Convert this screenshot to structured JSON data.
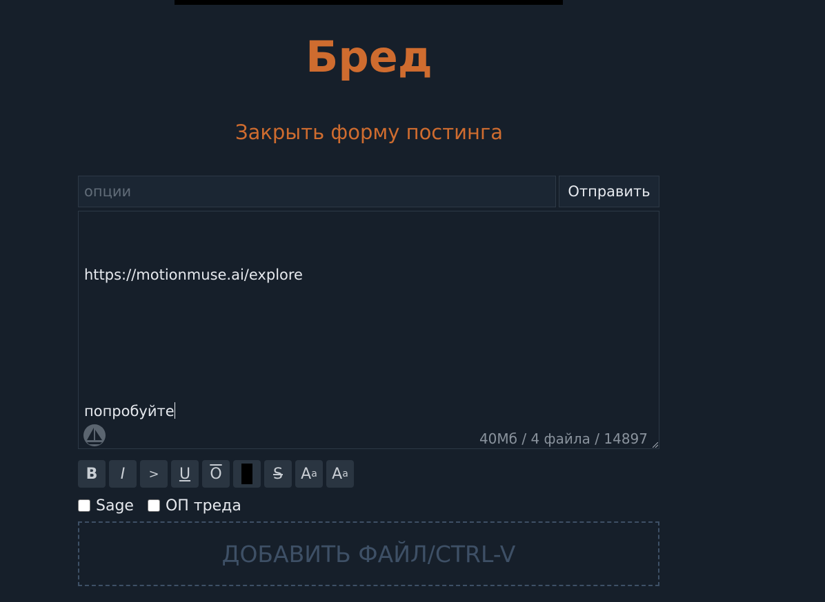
{
  "board": {
    "title": "Бред"
  },
  "form": {
    "close_label": "Закрыть форму постинга",
    "options_placeholder": "опции",
    "options_value": "",
    "submit_label": "Отправить",
    "message_lines": [
      "https://motionmuse.ai/explore",
      "",
      "попробуйте"
    ],
    "limits": "40Мб / 4 файла / 14897",
    "add_file_label": "ДОБАВИТЬ ФАЙЛ/CTRL-V"
  },
  "toolbar": {
    "bold": "B",
    "italic": "I",
    "quote": ">",
    "underline": "U",
    "overline": "O",
    "strike": "S",
    "sup_base": "A",
    "sup_mark": "a",
    "sub_base": "A",
    "sub_mark": "a"
  },
  "checkboxes": {
    "sage_label": "Sage",
    "sage_checked": false,
    "op_label": "ОП треда",
    "op_checked": false
  },
  "icons": {
    "sail": "sail-icon",
    "resize": "resize-handle-icon"
  },
  "colors": {
    "background": "#161f2a",
    "accent": "#cf6c2f",
    "input_bg": "#1b2633",
    "border": "#2d3946",
    "muted": "#8a939d",
    "dropzone": "#3e5066"
  }
}
